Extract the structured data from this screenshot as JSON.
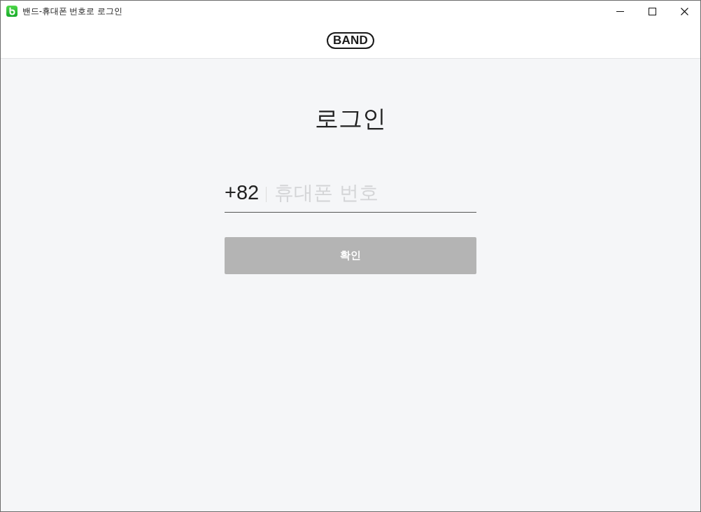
{
  "window": {
    "title": "밴드-휴대폰 번호로 로그인"
  },
  "header": {
    "logo": "BAND"
  },
  "login": {
    "heading": "로그인",
    "phone_field": {
      "country_code": "+82",
      "placeholder": "휴대폰 번호"
    },
    "confirm_button": {
      "label": "확인",
      "disabled": true
    }
  }
}
